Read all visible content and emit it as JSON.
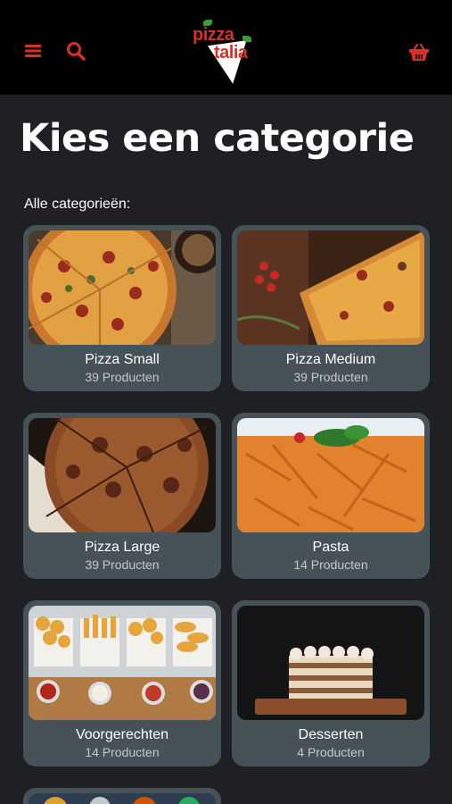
{
  "header": {
    "logo_text_top": "pizza",
    "logo_text_bottom": "talia",
    "accent_color": "#d93025",
    "icons": [
      "menu-icon",
      "search-icon",
      "basket-icon"
    ]
  },
  "page": {
    "title": "Kies een categorie",
    "section_label": "Alle categorieën:"
  },
  "categories": [
    {
      "name": "Pizza Small",
      "count": "39 Producten"
    },
    {
      "name": "Pizza Medium",
      "count": "39 Producten"
    },
    {
      "name": "Pizza Large",
      "count": "39 Producten"
    },
    {
      "name": "Pasta",
      "count": "14 Producten"
    },
    {
      "name": "Voorgerechten",
      "count": "14 Producten"
    },
    {
      "name": "Desserten",
      "count": "4 Producten"
    }
  ]
}
